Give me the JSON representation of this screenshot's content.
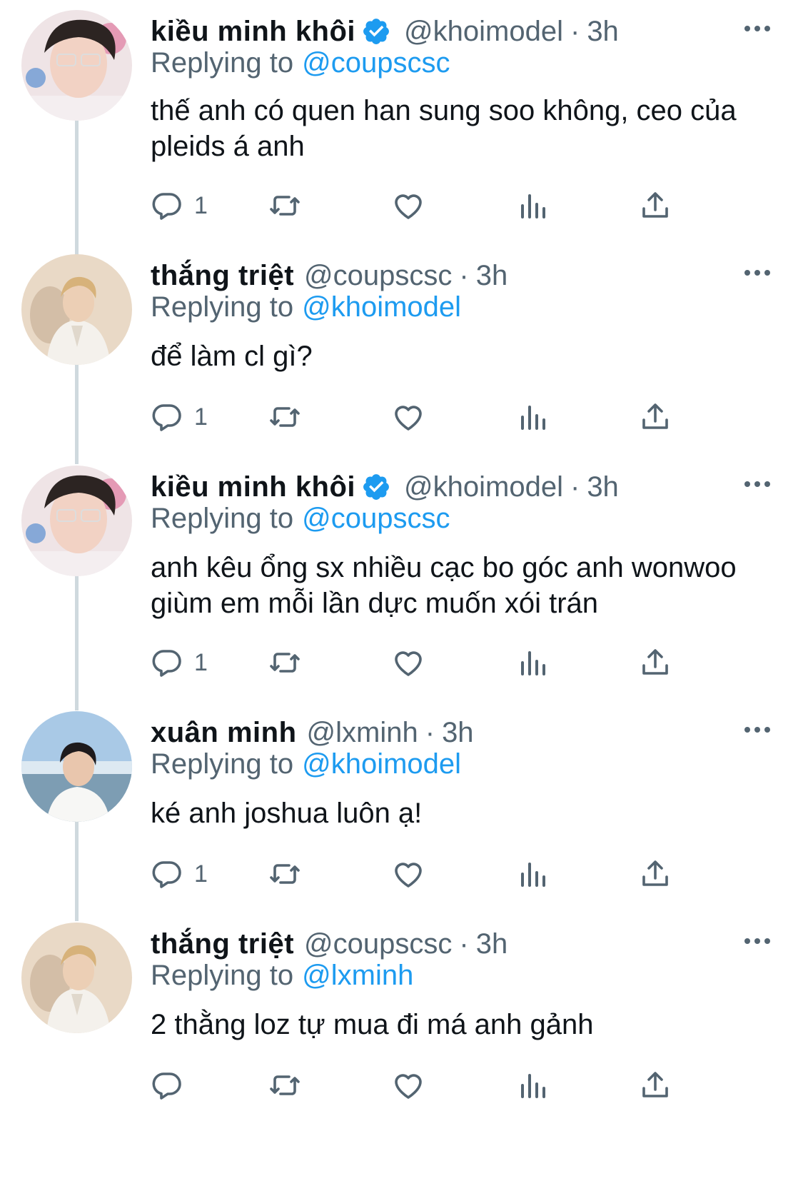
{
  "tweets": [
    {
      "name": "kiều minh khôi",
      "verified": true,
      "handle": "@khoimodel",
      "time": "3h",
      "replying_label": "Replying to",
      "reply_to": "@coupscsc",
      "text": "thế anh có quen han sung soo không, ceo của pleids á anh",
      "reply_count": "1",
      "avatar": "avatar-khoi"
    },
    {
      "name": "thắng triệt",
      "verified": false,
      "handle": "@coupscsc",
      "time": "3h",
      "replying_label": "Replying to",
      "reply_to": "@khoimodel",
      "text": "để làm cl gì?",
      "reply_count": "1",
      "avatar": "avatar-triet"
    },
    {
      "name": "kiều minh khôi",
      "verified": true,
      "handle": "@khoimodel",
      "time": "3h",
      "replying_label": "Replying to",
      "reply_to": "@coupscsc",
      "text": "anh kêu ổng sx nhiều cạc bo góc anh wonwoo giùm em mỗi lần dực muốn xói trán",
      "reply_count": "1",
      "avatar": "avatar-khoi"
    },
    {
      "name": "xuân minh",
      "verified": false,
      "handle": "@lxminh",
      "time": "3h",
      "replying_label": "Replying to",
      "reply_to": "@khoimodel",
      "text": "ké anh joshua luôn ạ!",
      "reply_count": "1",
      "avatar": "avatar-minh"
    },
    {
      "name": "thắng triệt",
      "verified": false,
      "handle": "@coupscsc",
      "time": "3h",
      "replying_label": "Replying to",
      "reply_to": "@lxminh",
      "text": "2 thằng loz tự mua đi má anh gảnh",
      "reply_count": "",
      "avatar": "avatar-triet"
    }
  ],
  "icons": {
    "reply": "reply-icon",
    "retweet": "retweet-icon",
    "like": "heart-icon",
    "analytics": "analytics-icon",
    "share": "share-icon",
    "more": "more-icon",
    "verified": "verified-badge-icon"
  },
  "colors": {
    "accent": "#1d9bf0",
    "secondary_text": "#536471",
    "thread_line": "#cfd9de"
  }
}
